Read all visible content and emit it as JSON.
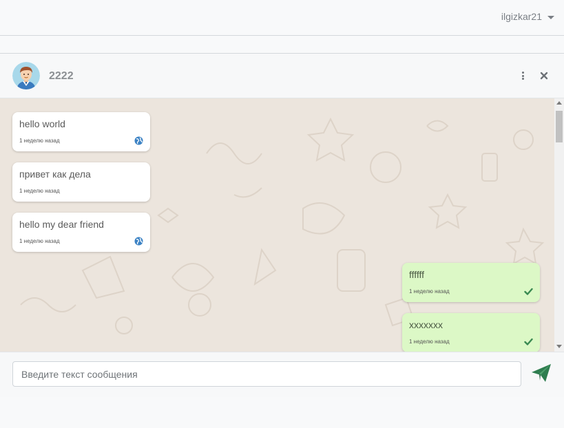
{
  "topbar": {
    "username": "ilgizkar21",
    "dropdown_icon": "caret-down-icon"
  },
  "chat": {
    "contact_name": "2222",
    "menu_icon": "vertical-dots-icon",
    "close_icon": "close-icon",
    "messages": [
      {
        "direction": "incoming",
        "text": "hello world",
        "time": "1 неделю назад",
        "status_icon": "globe-icon"
      },
      {
        "direction": "incoming",
        "text": "привет как дела",
        "time": "1 неделю назад",
        "status_icon": ""
      },
      {
        "direction": "incoming",
        "text": "hello my dear friend",
        "time": "1 неделю назад",
        "status_icon": "globe-icon"
      },
      {
        "direction": "outgoing",
        "text": "ffffff",
        "time": "1 неделю назад",
        "status_icon": "check-icon"
      },
      {
        "direction": "outgoing",
        "text": "xxxxxxx",
        "time": "1 неделю назад",
        "status_icon": "check-icon"
      }
    ]
  },
  "composer": {
    "placeholder": "Введите текст сообщения",
    "value": "",
    "send_icon": "paper-plane-icon"
  },
  "colors": {
    "incoming_bubble": "#ffffff",
    "outgoing_bubble": "#dcf8c6",
    "chat_background": "#ece5dd",
    "send_accent": "#2e7d4f",
    "globe": "#3b82c4",
    "check": "#3a8a52"
  }
}
